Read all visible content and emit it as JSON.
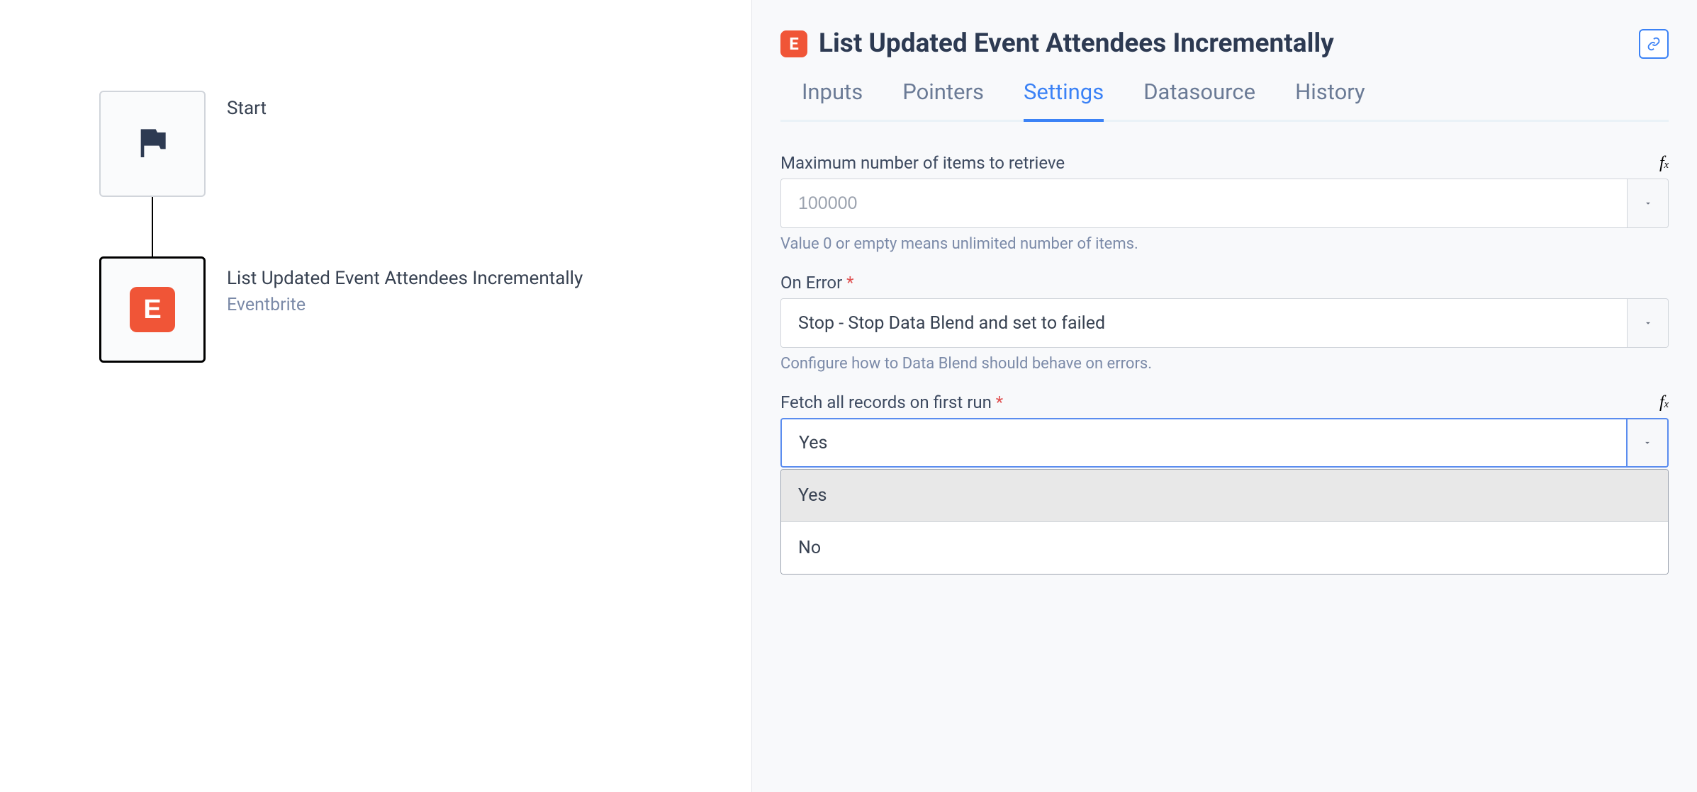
{
  "flow": {
    "start_label": "Start",
    "block_title": "List Updated Event Attendees Incrementally",
    "block_provider": "Eventbrite",
    "eb_glyph": "E"
  },
  "panel": {
    "icon_glyph": "E",
    "title": "List Updated Event Attendees Incrementally"
  },
  "tabs": {
    "inputs": "Inputs",
    "pointers": "Pointers",
    "settings": "Settings",
    "datasource": "Datasource",
    "history": "History",
    "active": "settings"
  },
  "fields": {
    "max_items": {
      "label": "Maximum number of items to retrieve",
      "placeholder": "100000",
      "value": "",
      "help": "Value 0 or empty means unlimited number of items."
    },
    "on_error": {
      "label": "On Error",
      "required_mark": "*",
      "value": "Stop - Stop Data Blend and set to failed",
      "help": "Configure how to Data Blend should behave on errors."
    },
    "fetch_all": {
      "label": "Fetch all records on first run",
      "required_mark": "*",
      "value": "Yes",
      "options": [
        "Yes",
        "No"
      ]
    }
  }
}
